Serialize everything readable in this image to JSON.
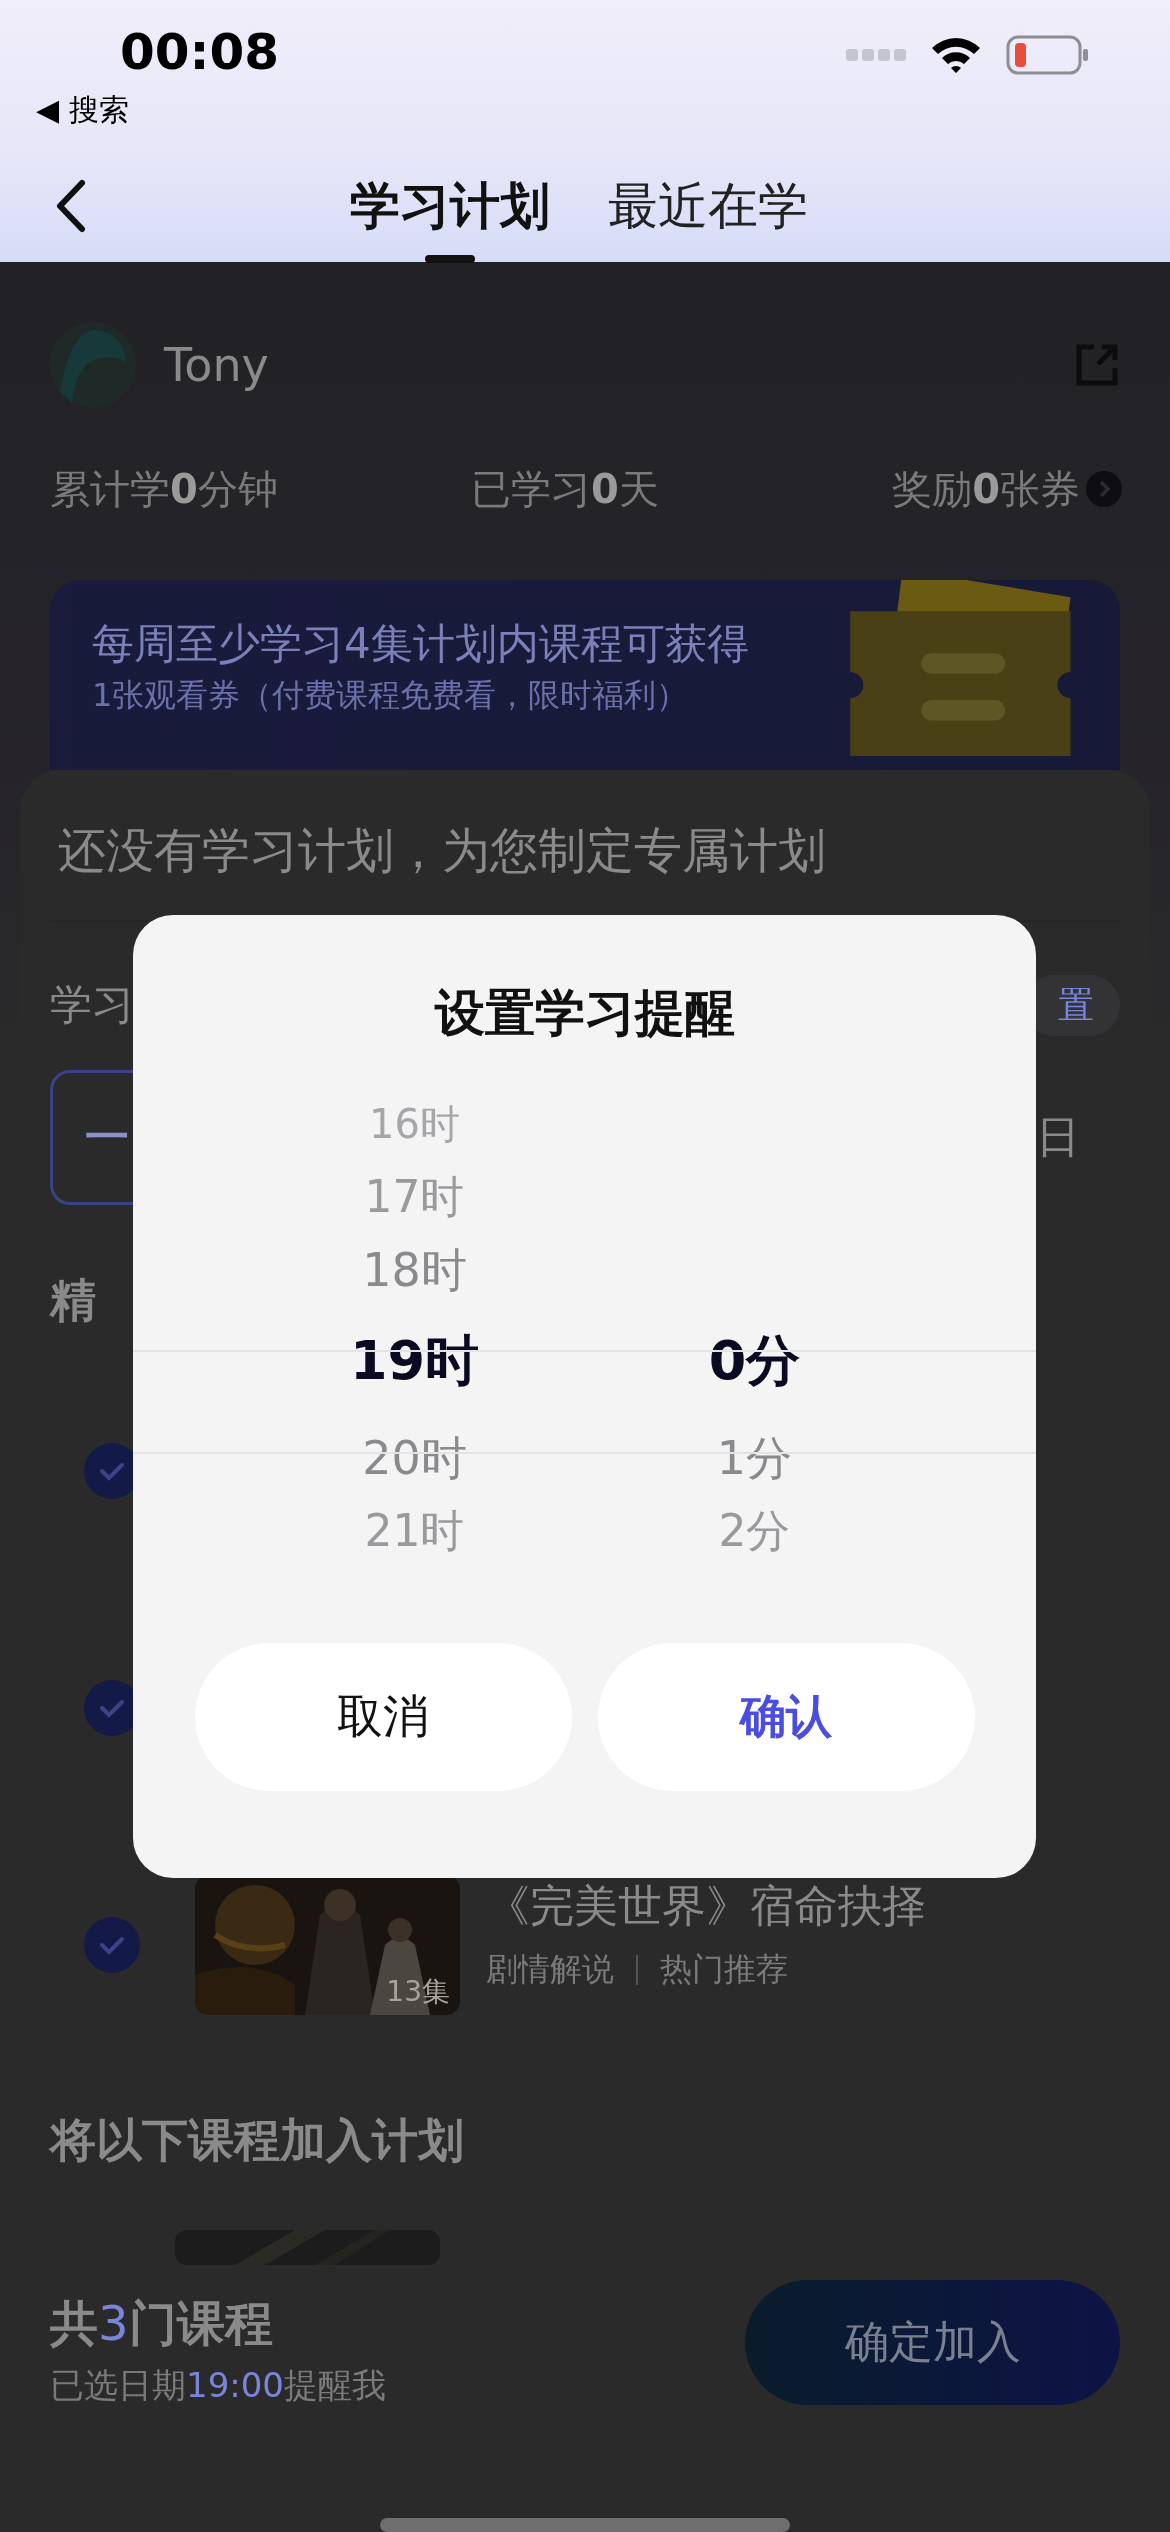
{
  "status_bar": {
    "time": "00:08",
    "back_label": "◀ 搜索"
  },
  "tabs": [
    {
      "label": "学习计划",
      "selected": true
    },
    {
      "label": "最近在学",
      "selected": false
    }
  ],
  "profile": {
    "name": "Tony"
  },
  "stats": [
    "累计学**0**分钟",
    "已学习**0**天",
    "奖励**0**张券"
  ],
  "banner": {
    "title": "每周至少学习4集计划内课程可获得",
    "subtitle": "1张观看券（付费课程免费看，限时福利）"
  },
  "plan": {
    "title": "还没有学习计划，为您制定专属计划",
    "row_label": "学习",
    "row_action": "置",
    "days": [
      {
        "label": "一",
        "selected": true
      },
      {
        "label": "日",
        "selected": false
      }
    ]
  },
  "featured": {
    "heading": "精",
    "courses": [
      {
        "checked": true
      },
      {
        "checked": true
      },
      {
        "checked": true,
        "title": "《完美世界》宿命抉择",
        "tags": [
          "剧情解说",
          "热门推荐"
        ],
        "episodes": "13集"
      }
    ]
  },
  "add_section": {
    "heading": "将以下课程加入计划"
  },
  "footer": {
    "count": {
      "prefix": "共",
      "value": "3",
      "suffix": "门课程"
    },
    "reminder": {
      "prefix": "已选日期",
      "value": "19:00",
      "suffix": "提醒我"
    },
    "button": "确定加入"
  },
  "dialog": {
    "title": "设置学习提醒",
    "hours": [
      {
        "label": "16时",
        "selected": false
      },
      {
        "label": "17时",
        "selected": false
      },
      {
        "label": "18时",
        "selected": false
      },
      {
        "label": "19时",
        "selected": true
      },
      {
        "label": "20时",
        "selected": false
      },
      {
        "label": "21时",
        "selected": false
      }
    ],
    "minutes": [
      {
        "label": "0分",
        "selected": true
      },
      {
        "label": "1分",
        "selected": false
      },
      {
        "label": "2分",
        "selected": false
      }
    ],
    "buttons": [
      {
        "kind": "cancel",
        "label": "取消"
      },
      {
        "kind": "confirm",
        "label": "确认"
      }
    ]
  }
}
